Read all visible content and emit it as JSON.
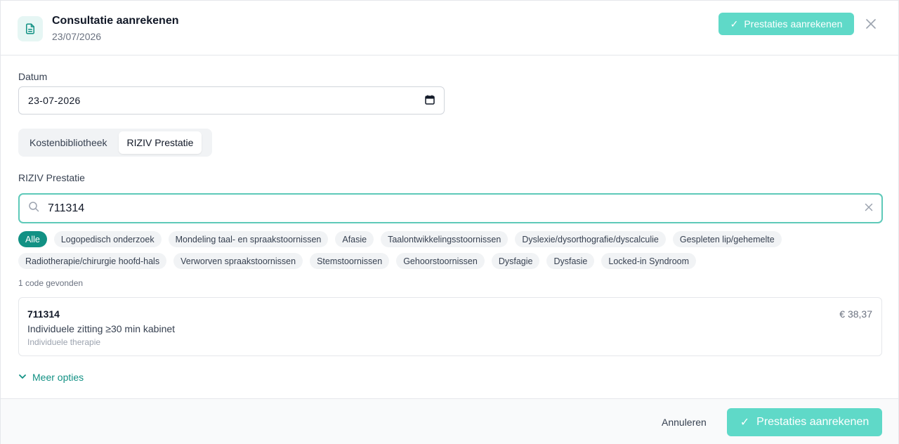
{
  "header": {
    "title": "Consultatie aanrekenen",
    "date": "23/07/2026",
    "primary_label": "Prestaties aanrekenen"
  },
  "form": {
    "date_label": "Datum",
    "date_value": "23-07-2026",
    "tabs": [
      {
        "label": "Kostenbibliotheek",
        "active": false
      },
      {
        "label": "RIZIV Prestatie",
        "active": true
      }
    ],
    "riziv_label": "RIZIV Prestatie",
    "search_value": "711314"
  },
  "filters": {
    "row1": [
      "Alle",
      "Logopedisch onderzoek",
      "Mondeling taal- en spraakstoornissen",
      "Afasie",
      "Taalontwikkelingsstoornissen",
      "Dyslexie/dysorthografie/dyscalculie",
      "Gespleten lip/gehemelte"
    ],
    "row2": [
      "Radiotherapie/chirurgie hoofd-hals",
      "Verworven spraakstoornissen",
      "Stemstoornissen",
      "Gehoorstoornissen",
      "Dysfagie",
      "Dysfasie",
      "Locked-in Syndroom"
    ],
    "active": "Alle"
  },
  "results": {
    "count_text": "1 code gevonden",
    "items": [
      {
        "code": "711314",
        "description": "Individuele zitting ≥30 min kabinet",
        "category": "Individuele therapie",
        "price": "€ 38,37"
      }
    ]
  },
  "more_options": "Meer opties",
  "footer": {
    "cancel_label": "Annuleren",
    "primary_label": "Prestaties aanrekenen"
  },
  "colors": {
    "accent": "#129184",
    "primary_button": "#5fd9c8",
    "focus_border": "#5ec9b9"
  },
  "icons": [
    "document-icon",
    "check-icon",
    "close-icon",
    "calendar-icon",
    "search-icon",
    "clear-icon",
    "chevron-down-icon"
  ]
}
